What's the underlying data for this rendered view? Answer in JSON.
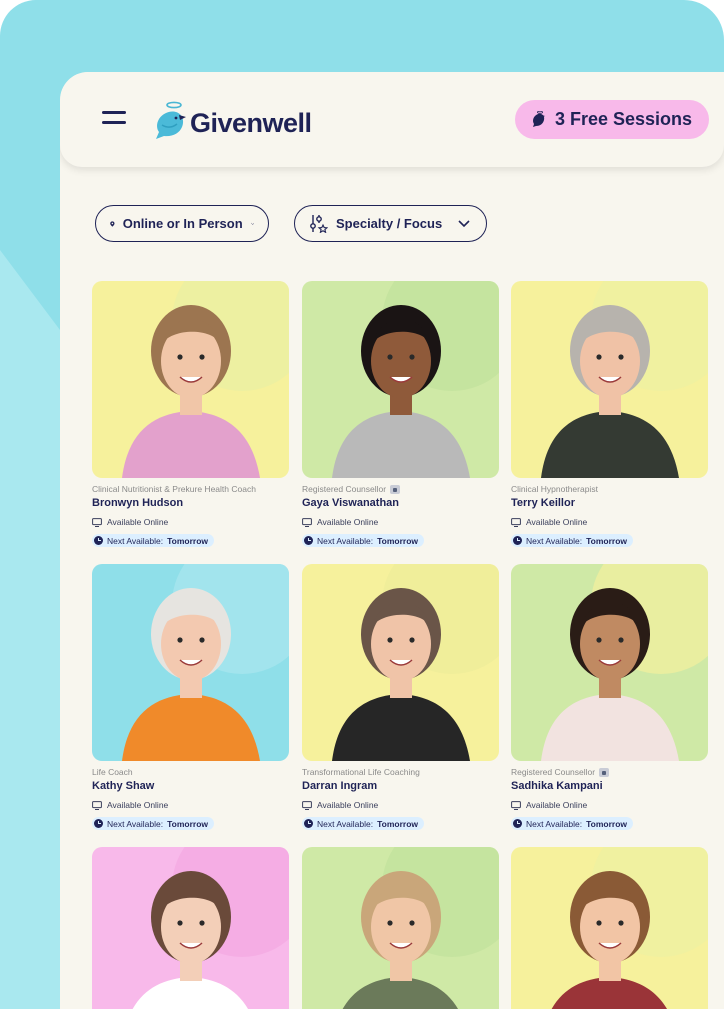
{
  "brand": {
    "name": "Givenwell"
  },
  "header": {
    "cta_label": "3 Free Sessions",
    "icons": {
      "menu": "hamburger-menu-icon",
      "logo": "bird-logo-icon",
      "cta": "bird-icon"
    }
  },
  "filters": [
    {
      "label": "Online or In Person",
      "icon": "location-pin-icon"
    },
    {
      "label": "Specialty /  Focus",
      "icon": "sliders-icon"
    }
  ],
  "availability": {
    "online_label": "Available Online",
    "next_prefix": "Next Available:"
  },
  "practitioners": [
    {
      "role": "Clinical Nutritionist & Prekure Health Coach",
      "name": "Bronwyn Hudson",
      "verified": false,
      "next": "Tomorrow",
      "bg": "#f6f19c",
      "accent": "#e9efa3"
    },
    {
      "role": "Registered Counsellor",
      "name": "Gaya Viswanathan",
      "verified": true,
      "next": "Tomorrow",
      "bg": "#cfe9a6",
      "accent": "#c2e29c"
    },
    {
      "role": "Clinical Hypnotherapist",
      "name": "Terry Keillor",
      "verified": false,
      "next": "Tomorrow",
      "bg": "#f6f19c",
      "accent": "#eef0a2"
    },
    {
      "role": "Life Coach",
      "name": "Kathy Shaw",
      "verified": false,
      "next": "Tomorrow",
      "bg": "#8fdfe9",
      "accent": "#a8e6ee"
    },
    {
      "role": "Transformational Life Coaching",
      "name": "Darran Ingram",
      "verified": false,
      "next": "Tomorrow",
      "bg": "#f6f19c",
      "accent": "#eeec99"
    },
    {
      "role": "Registered Counsellor",
      "name": "Sadhika Kampani",
      "verified": true,
      "next": "Tomorrow",
      "bg": "#cfe9a6",
      "accent": "#f2ef9e"
    },
    {
      "role": "",
      "name": "",
      "verified": false,
      "next": "",
      "bg": "#f8b9ea",
      "accent": "#f4a9e1"
    },
    {
      "role": "",
      "name": "",
      "verified": false,
      "next": "",
      "bg": "#cfe9a6",
      "accent": "#c2e29c"
    },
    {
      "role": "",
      "name": "",
      "verified": false,
      "next": "",
      "bg": "#f6f19c",
      "accent": "#eef0a2"
    }
  ]
}
